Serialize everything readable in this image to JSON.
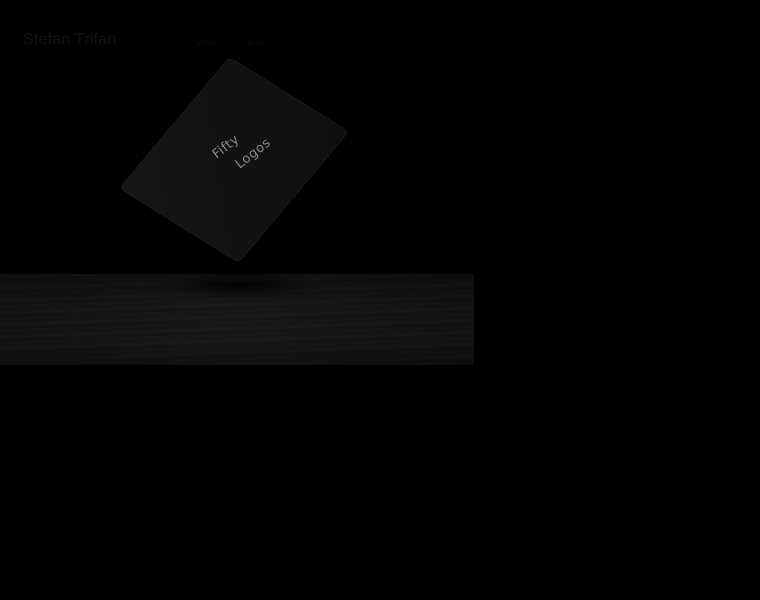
{
  "header": {
    "site_title": "Stefan Trifan",
    "nav": [
      {
        "label": "Work"
      },
      {
        "label": "Info"
      }
    ]
  },
  "hero": {
    "book_title_line1": "Fifty",
    "book_title_line2": "Logos"
  },
  "colors": {
    "background": "#000000",
    "title_text": "#121212",
    "book_cover": "#141414",
    "cover_text": "#8a8a8a",
    "wood": "#0f0f0f"
  }
}
